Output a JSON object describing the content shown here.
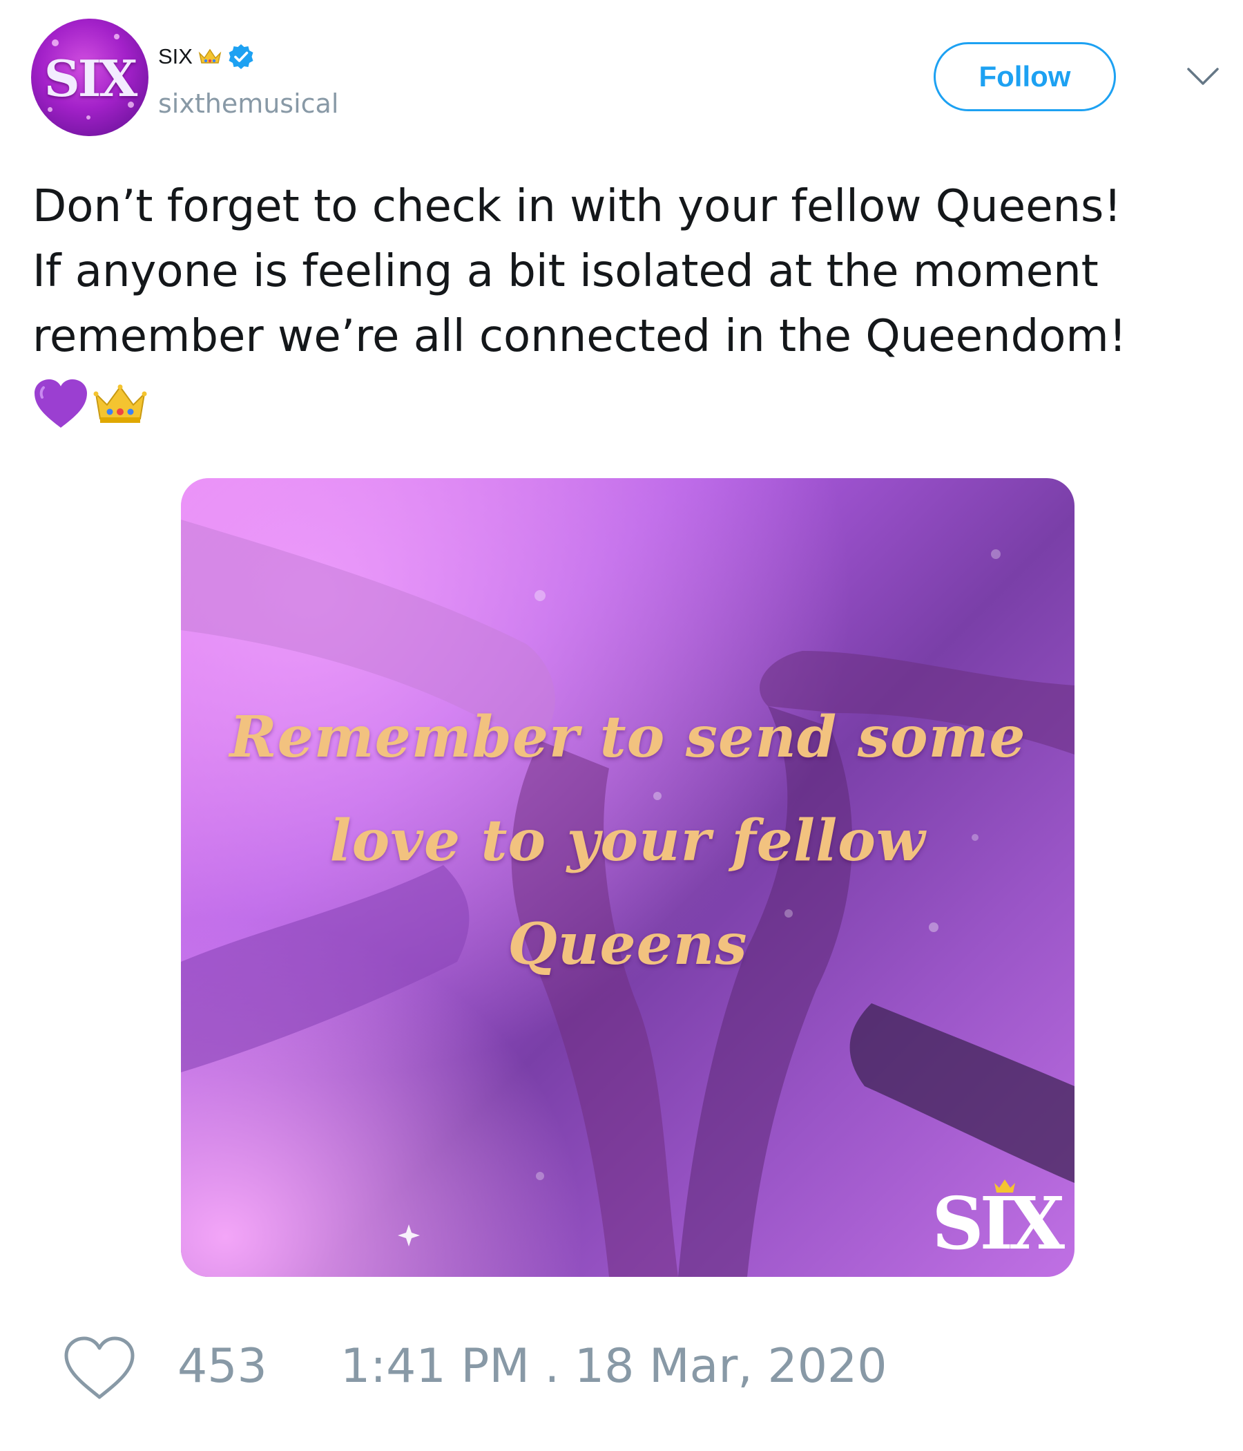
{
  "account": {
    "display_name": "SIX",
    "handle": "sixthemusical",
    "avatar_logo_text": "SIX",
    "name_badge_icon": "crown-emoji-icon",
    "verified_icon": "verified-badge-icon"
  },
  "header": {
    "follow_label": "Follow",
    "menu_icon": "chevron-down-icon"
  },
  "tweet": {
    "text": "Don’t forget to check in with your fellow Queens!\nIf anyone is feeling a bit isolated at the moment\nremember we’re all connected in the Queendom!",
    "emojis": [
      "purple-heart-emoji-icon",
      "crown-emoji-icon"
    ]
  },
  "media": {
    "caption_line1": "Remember to send some",
    "caption_line2": "love to your fellow",
    "caption_line3": "Queens",
    "logo_text": "SIX"
  },
  "footer": {
    "like_icon": "heart-outline-icon",
    "like_count": "453",
    "timestamp": "1:41 PM . 18 Mar, 2020"
  },
  "colors": {
    "accent": "#1da1f2",
    "muted": "#8899a6",
    "text": "#14171a",
    "caption": "#f2c27f",
    "purple": "#a321c9"
  }
}
